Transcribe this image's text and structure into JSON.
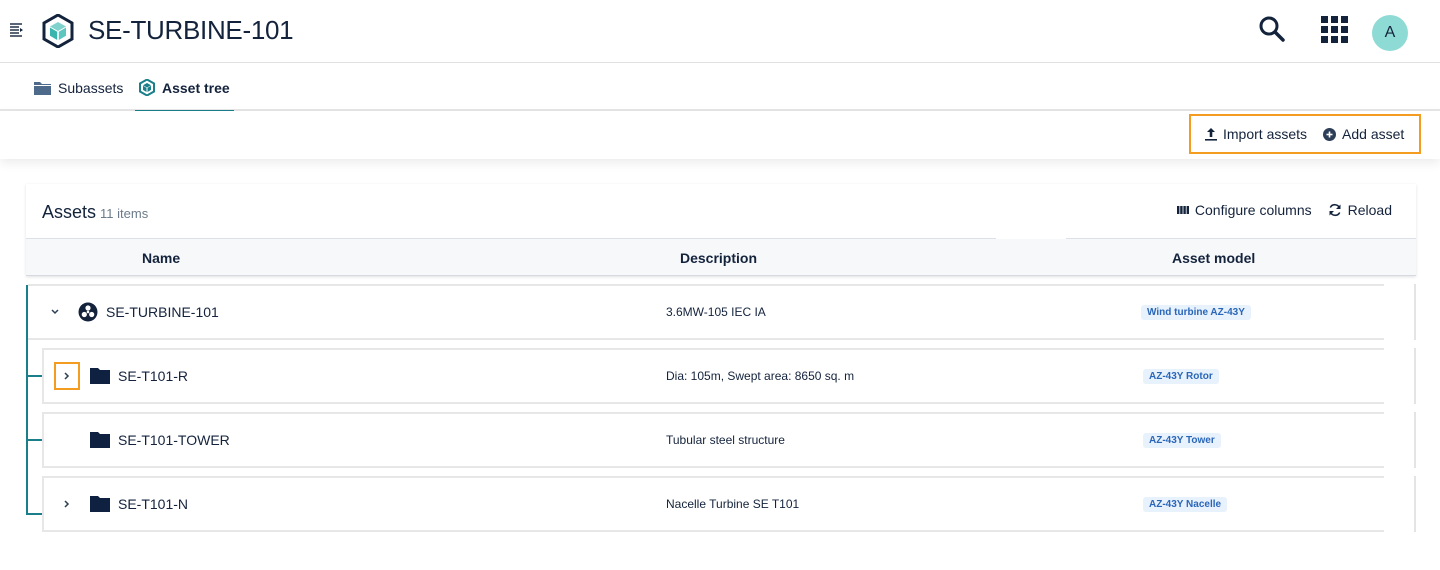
{
  "header": {
    "title": "SE-TURBINE-101",
    "avatar_initial": "A",
    "icons": [
      "menu-toggle-icon",
      "asset-cube-icon",
      "search-icon",
      "apps-grid-icon"
    ]
  },
  "tabs": [
    {
      "label": "Subassets",
      "icon": "folder-icon",
      "active": false
    },
    {
      "label": "Asset tree",
      "icon": "asset-cube-icon",
      "active": true
    }
  ],
  "actions": {
    "import_label": "Import assets",
    "add_label": "Add asset"
  },
  "card": {
    "title": "Assets",
    "count": "11 items",
    "configure_label": "Configure columns",
    "reload_label": "Reload",
    "columns": [
      "Name",
      "Description",
      "Asset model"
    ]
  },
  "rows": [
    {
      "name": "SE-TURBINE-101",
      "description": "3.6MW-105 IEC IA",
      "model": "Wind turbine AZ-43Y",
      "expanded": true,
      "icon": "wind-turbine-icon"
    },
    {
      "name": "SE-T101-R",
      "description": "Dia: 105m, Swept area: 8650 sq. m",
      "model": "AZ-43Y Rotor",
      "expanded": false,
      "icon": "folder-icon"
    },
    {
      "name": "SE-T101-TOWER",
      "description": "Tubular steel structure",
      "model": "AZ-43Y Tower",
      "expanded": false,
      "icon": "folder-icon"
    },
    {
      "name": "SE-T101-N",
      "description": "Nacelle Turbine SE T101",
      "model": "AZ-43Y Nacelle",
      "expanded": false,
      "icon": "folder-icon"
    }
  ],
  "colors": {
    "accent": "#1a7f8a",
    "highlight": "#f39c1f",
    "text": "#14233c",
    "badge_bg": "#e8f2fd",
    "badge_text": "#2a66b8",
    "avatar": "#8edbd6"
  }
}
